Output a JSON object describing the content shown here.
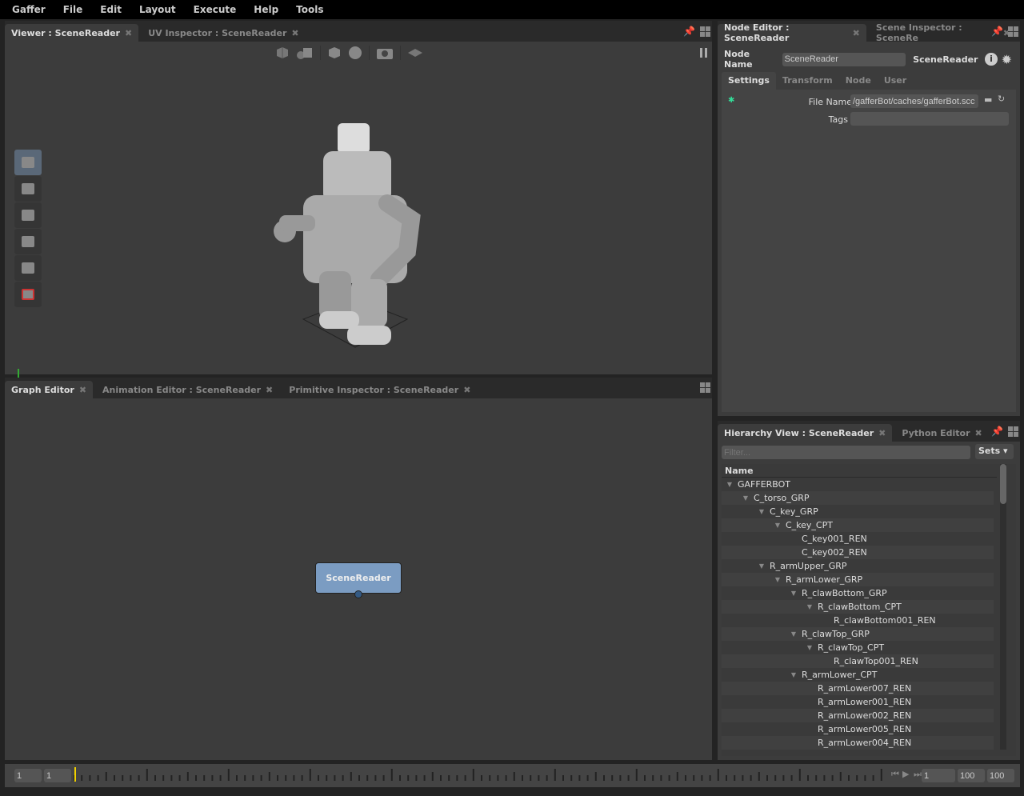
{
  "menu": [
    "Gaffer",
    "File",
    "Edit",
    "Layout",
    "Execute",
    "Help",
    "Tools"
  ],
  "viewer": {
    "tabs": [
      {
        "label": "Viewer : SceneReader",
        "active": true
      },
      {
        "label": "UV Inspector : SceneReader",
        "active": false
      }
    ],
    "toolbar_icons": [
      "selection-mask-icon",
      "shading-mode-icon",
      "camera-cube-icon",
      "sphere-icon",
      "camera-icon",
      "grid-icon"
    ],
    "tools": [
      "selection-tool",
      "translate-tool",
      "rotate-tool",
      "scale-tool",
      "camera-tool",
      "crop-window-tool"
    ]
  },
  "node_editor": {
    "tabs": [
      {
        "label": "Node Editor : SceneReader",
        "active": true
      },
      {
        "label": "Scene Inspector : SceneRe",
        "active": false
      }
    ],
    "node_name_label": "Node Name",
    "node_name_value": "SceneReader",
    "node_type": "SceneReader",
    "sections": [
      "Settings",
      "Transform",
      "Node",
      "User"
    ],
    "file_name_label": "File Name",
    "file_name_value": "/gafferBot/caches/gafferBot.scc",
    "tags_label": "Tags",
    "tags_value": ""
  },
  "graph": {
    "tabs": [
      {
        "label": "Graph Editor",
        "active": true
      },
      {
        "label": "Animation Editor : SceneReader",
        "active": false
      },
      {
        "label": "Primitive Inspector : SceneReader",
        "active": false
      }
    ],
    "node_label": "SceneReader",
    "node_color": "#7b9cc2"
  },
  "hierarchy": {
    "tabs": [
      {
        "label": "Hierarchy View : SceneReader",
        "active": true
      },
      {
        "label": "Python Editor",
        "active": false
      }
    ],
    "filter_placeholder": "Filter...",
    "sets_label": "Sets",
    "column": "Name",
    "rows": [
      {
        "name": "GAFFERBOT",
        "depth": 0,
        "expanded": true
      },
      {
        "name": "C_torso_GRP",
        "depth": 1,
        "expanded": true
      },
      {
        "name": "C_key_GRP",
        "depth": 2,
        "expanded": true
      },
      {
        "name": "C_key_CPT",
        "depth": 3,
        "expanded": true
      },
      {
        "name": "C_key001_REN",
        "depth": 4,
        "expanded": false
      },
      {
        "name": "C_key002_REN",
        "depth": 4,
        "expanded": false
      },
      {
        "name": "R_armUpper_GRP",
        "depth": 2,
        "expanded": true
      },
      {
        "name": "R_armLower_GRP",
        "depth": 3,
        "expanded": true
      },
      {
        "name": "R_clawBottom_GRP",
        "depth": 4,
        "expanded": true
      },
      {
        "name": "R_clawBottom_CPT",
        "depth": 5,
        "expanded": true
      },
      {
        "name": "R_clawBottom001_REN",
        "depth": 6,
        "expanded": false
      },
      {
        "name": "R_clawTop_GRP",
        "depth": 4,
        "expanded": true
      },
      {
        "name": "R_clawTop_CPT",
        "depth": 5,
        "expanded": true
      },
      {
        "name": "R_clawTop001_REN",
        "depth": 6,
        "expanded": false
      },
      {
        "name": "R_armLower_CPT",
        "depth": 4,
        "expanded": true
      },
      {
        "name": "R_armLower007_REN",
        "depth": 5,
        "expanded": false
      },
      {
        "name": "R_armLower001_REN",
        "depth": 5,
        "expanded": false
      },
      {
        "name": "R_armLower002_REN",
        "depth": 5,
        "expanded": false
      },
      {
        "name": "R_armLower005_REN",
        "depth": 5,
        "expanded": false
      },
      {
        "name": "R_armLower004_REN",
        "depth": 5,
        "expanded": false
      }
    ]
  },
  "timeline": {
    "start": "1",
    "current": "1",
    "frame": "1",
    "end": "100",
    "max": "100",
    "playhead_color": "#f0d000"
  }
}
